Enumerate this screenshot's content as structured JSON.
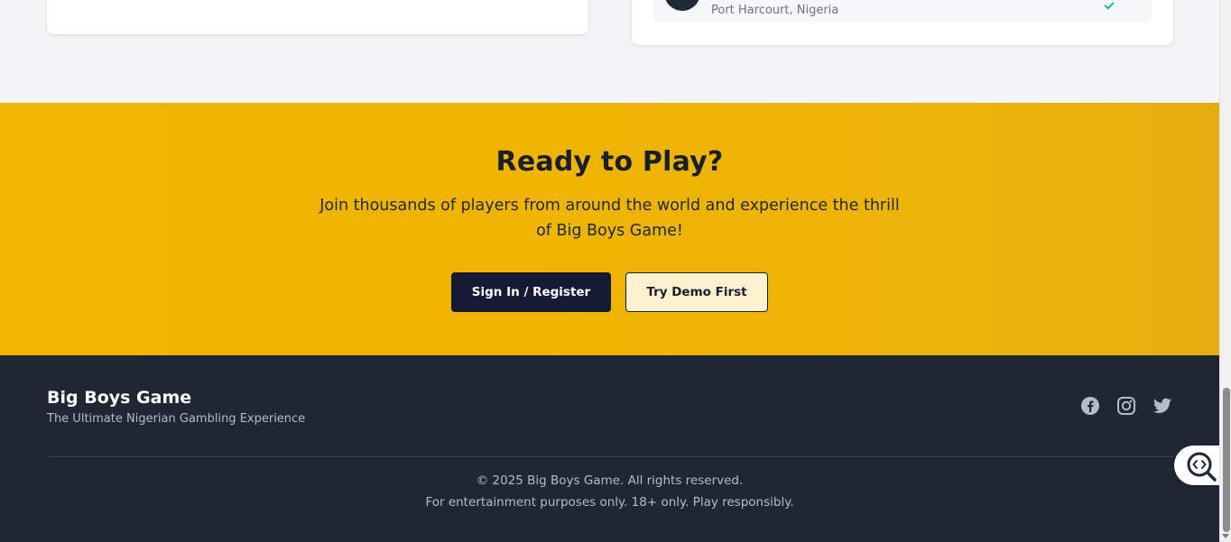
{
  "location_card": {
    "location_text": "Port Harcourt, Nigeria",
    "icon": "building-icon",
    "status_icon": "check-icon"
  },
  "cta": {
    "title": "Ready to Play?",
    "description": "Join thousands of players from around the world and experience the thrill of Big Boys Game!",
    "primary_button": "Sign In / Register",
    "secondary_button": "Try Demo First"
  },
  "footer": {
    "brand_name": "Big Boys Game",
    "tagline": "The Ultimate Nigerian Gambling Experience",
    "social_icons": [
      "facebook-icon",
      "instagram-icon",
      "twitter-icon"
    ],
    "copyright": "© 2025 Big Boys Game. All rights reserved.",
    "disclaimer": "For entertainment purposes only. 18+ only. Play responsibly."
  },
  "floating_button": {
    "icon": "code-search-icon"
  },
  "colors": {
    "cta_background": "#f0b400",
    "footer_background": "#1f2735",
    "primary_button": "#141a33",
    "secondary_button": "#fdf0cc"
  }
}
